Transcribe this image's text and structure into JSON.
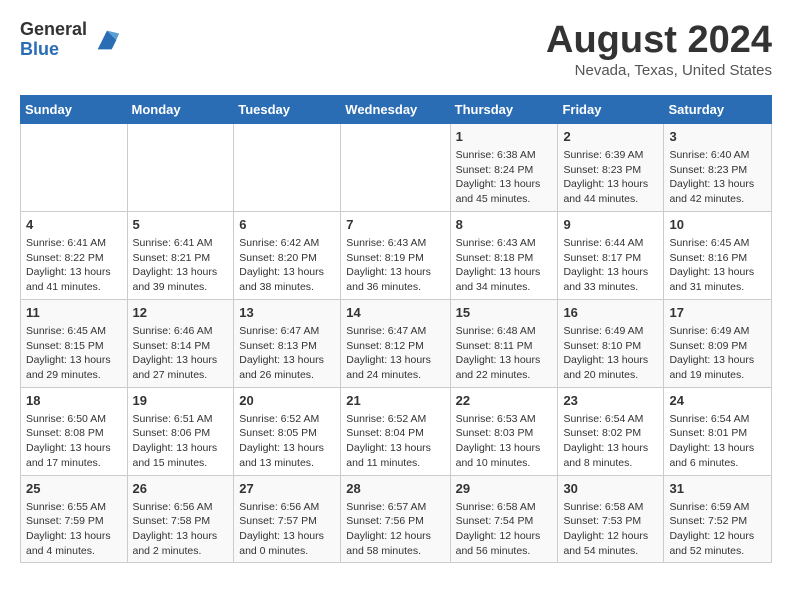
{
  "logo": {
    "general": "General",
    "blue": "Blue"
  },
  "title": "August 2024",
  "subtitle": "Nevada, Texas, United States",
  "days_of_week": [
    "Sunday",
    "Monday",
    "Tuesday",
    "Wednesday",
    "Thursday",
    "Friday",
    "Saturday"
  ],
  "weeks": [
    [
      {
        "day": "",
        "info": ""
      },
      {
        "day": "",
        "info": ""
      },
      {
        "day": "",
        "info": ""
      },
      {
        "day": "",
        "info": ""
      },
      {
        "day": "1",
        "info": "Sunrise: 6:38 AM\nSunset: 8:24 PM\nDaylight: 13 hours and 45 minutes."
      },
      {
        "day": "2",
        "info": "Sunrise: 6:39 AM\nSunset: 8:23 PM\nDaylight: 13 hours and 44 minutes."
      },
      {
        "day": "3",
        "info": "Sunrise: 6:40 AM\nSunset: 8:23 PM\nDaylight: 13 hours and 42 minutes."
      }
    ],
    [
      {
        "day": "4",
        "info": "Sunrise: 6:41 AM\nSunset: 8:22 PM\nDaylight: 13 hours and 41 minutes."
      },
      {
        "day": "5",
        "info": "Sunrise: 6:41 AM\nSunset: 8:21 PM\nDaylight: 13 hours and 39 minutes."
      },
      {
        "day": "6",
        "info": "Sunrise: 6:42 AM\nSunset: 8:20 PM\nDaylight: 13 hours and 38 minutes."
      },
      {
        "day": "7",
        "info": "Sunrise: 6:43 AM\nSunset: 8:19 PM\nDaylight: 13 hours and 36 minutes."
      },
      {
        "day": "8",
        "info": "Sunrise: 6:43 AM\nSunset: 8:18 PM\nDaylight: 13 hours and 34 minutes."
      },
      {
        "day": "9",
        "info": "Sunrise: 6:44 AM\nSunset: 8:17 PM\nDaylight: 13 hours and 33 minutes."
      },
      {
        "day": "10",
        "info": "Sunrise: 6:45 AM\nSunset: 8:16 PM\nDaylight: 13 hours and 31 minutes."
      }
    ],
    [
      {
        "day": "11",
        "info": "Sunrise: 6:45 AM\nSunset: 8:15 PM\nDaylight: 13 hours and 29 minutes."
      },
      {
        "day": "12",
        "info": "Sunrise: 6:46 AM\nSunset: 8:14 PM\nDaylight: 13 hours and 27 minutes."
      },
      {
        "day": "13",
        "info": "Sunrise: 6:47 AM\nSunset: 8:13 PM\nDaylight: 13 hours and 26 minutes."
      },
      {
        "day": "14",
        "info": "Sunrise: 6:47 AM\nSunset: 8:12 PM\nDaylight: 13 hours and 24 minutes."
      },
      {
        "day": "15",
        "info": "Sunrise: 6:48 AM\nSunset: 8:11 PM\nDaylight: 13 hours and 22 minutes."
      },
      {
        "day": "16",
        "info": "Sunrise: 6:49 AM\nSunset: 8:10 PM\nDaylight: 13 hours and 20 minutes."
      },
      {
        "day": "17",
        "info": "Sunrise: 6:49 AM\nSunset: 8:09 PM\nDaylight: 13 hours and 19 minutes."
      }
    ],
    [
      {
        "day": "18",
        "info": "Sunrise: 6:50 AM\nSunset: 8:08 PM\nDaylight: 13 hours and 17 minutes."
      },
      {
        "day": "19",
        "info": "Sunrise: 6:51 AM\nSunset: 8:06 PM\nDaylight: 13 hours and 15 minutes."
      },
      {
        "day": "20",
        "info": "Sunrise: 6:52 AM\nSunset: 8:05 PM\nDaylight: 13 hours and 13 minutes."
      },
      {
        "day": "21",
        "info": "Sunrise: 6:52 AM\nSunset: 8:04 PM\nDaylight: 13 hours and 11 minutes."
      },
      {
        "day": "22",
        "info": "Sunrise: 6:53 AM\nSunset: 8:03 PM\nDaylight: 13 hours and 10 minutes."
      },
      {
        "day": "23",
        "info": "Sunrise: 6:54 AM\nSunset: 8:02 PM\nDaylight: 13 hours and 8 minutes."
      },
      {
        "day": "24",
        "info": "Sunrise: 6:54 AM\nSunset: 8:01 PM\nDaylight: 13 hours and 6 minutes."
      }
    ],
    [
      {
        "day": "25",
        "info": "Sunrise: 6:55 AM\nSunset: 7:59 PM\nDaylight: 13 hours and 4 minutes."
      },
      {
        "day": "26",
        "info": "Sunrise: 6:56 AM\nSunset: 7:58 PM\nDaylight: 13 hours and 2 minutes."
      },
      {
        "day": "27",
        "info": "Sunrise: 6:56 AM\nSunset: 7:57 PM\nDaylight: 13 hours and 0 minutes."
      },
      {
        "day": "28",
        "info": "Sunrise: 6:57 AM\nSunset: 7:56 PM\nDaylight: 12 hours and 58 minutes."
      },
      {
        "day": "29",
        "info": "Sunrise: 6:58 AM\nSunset: 7:54 PM\nDaylight: 12 hours and 56 minutes."
      },
      {
        "day": "30",
        "info": "Sunrise: 6:58 AM\nSunset: 7:53 PM\nDaylight: 12 hours and 54 minutes."
      },
      {
        "day": "31",
        "info": "Sunrise: 6:59 AM\nSunset: 7:52 PM\nDaylight: 12 hours and 52 minutes."
      }
    ]
  ]
}
